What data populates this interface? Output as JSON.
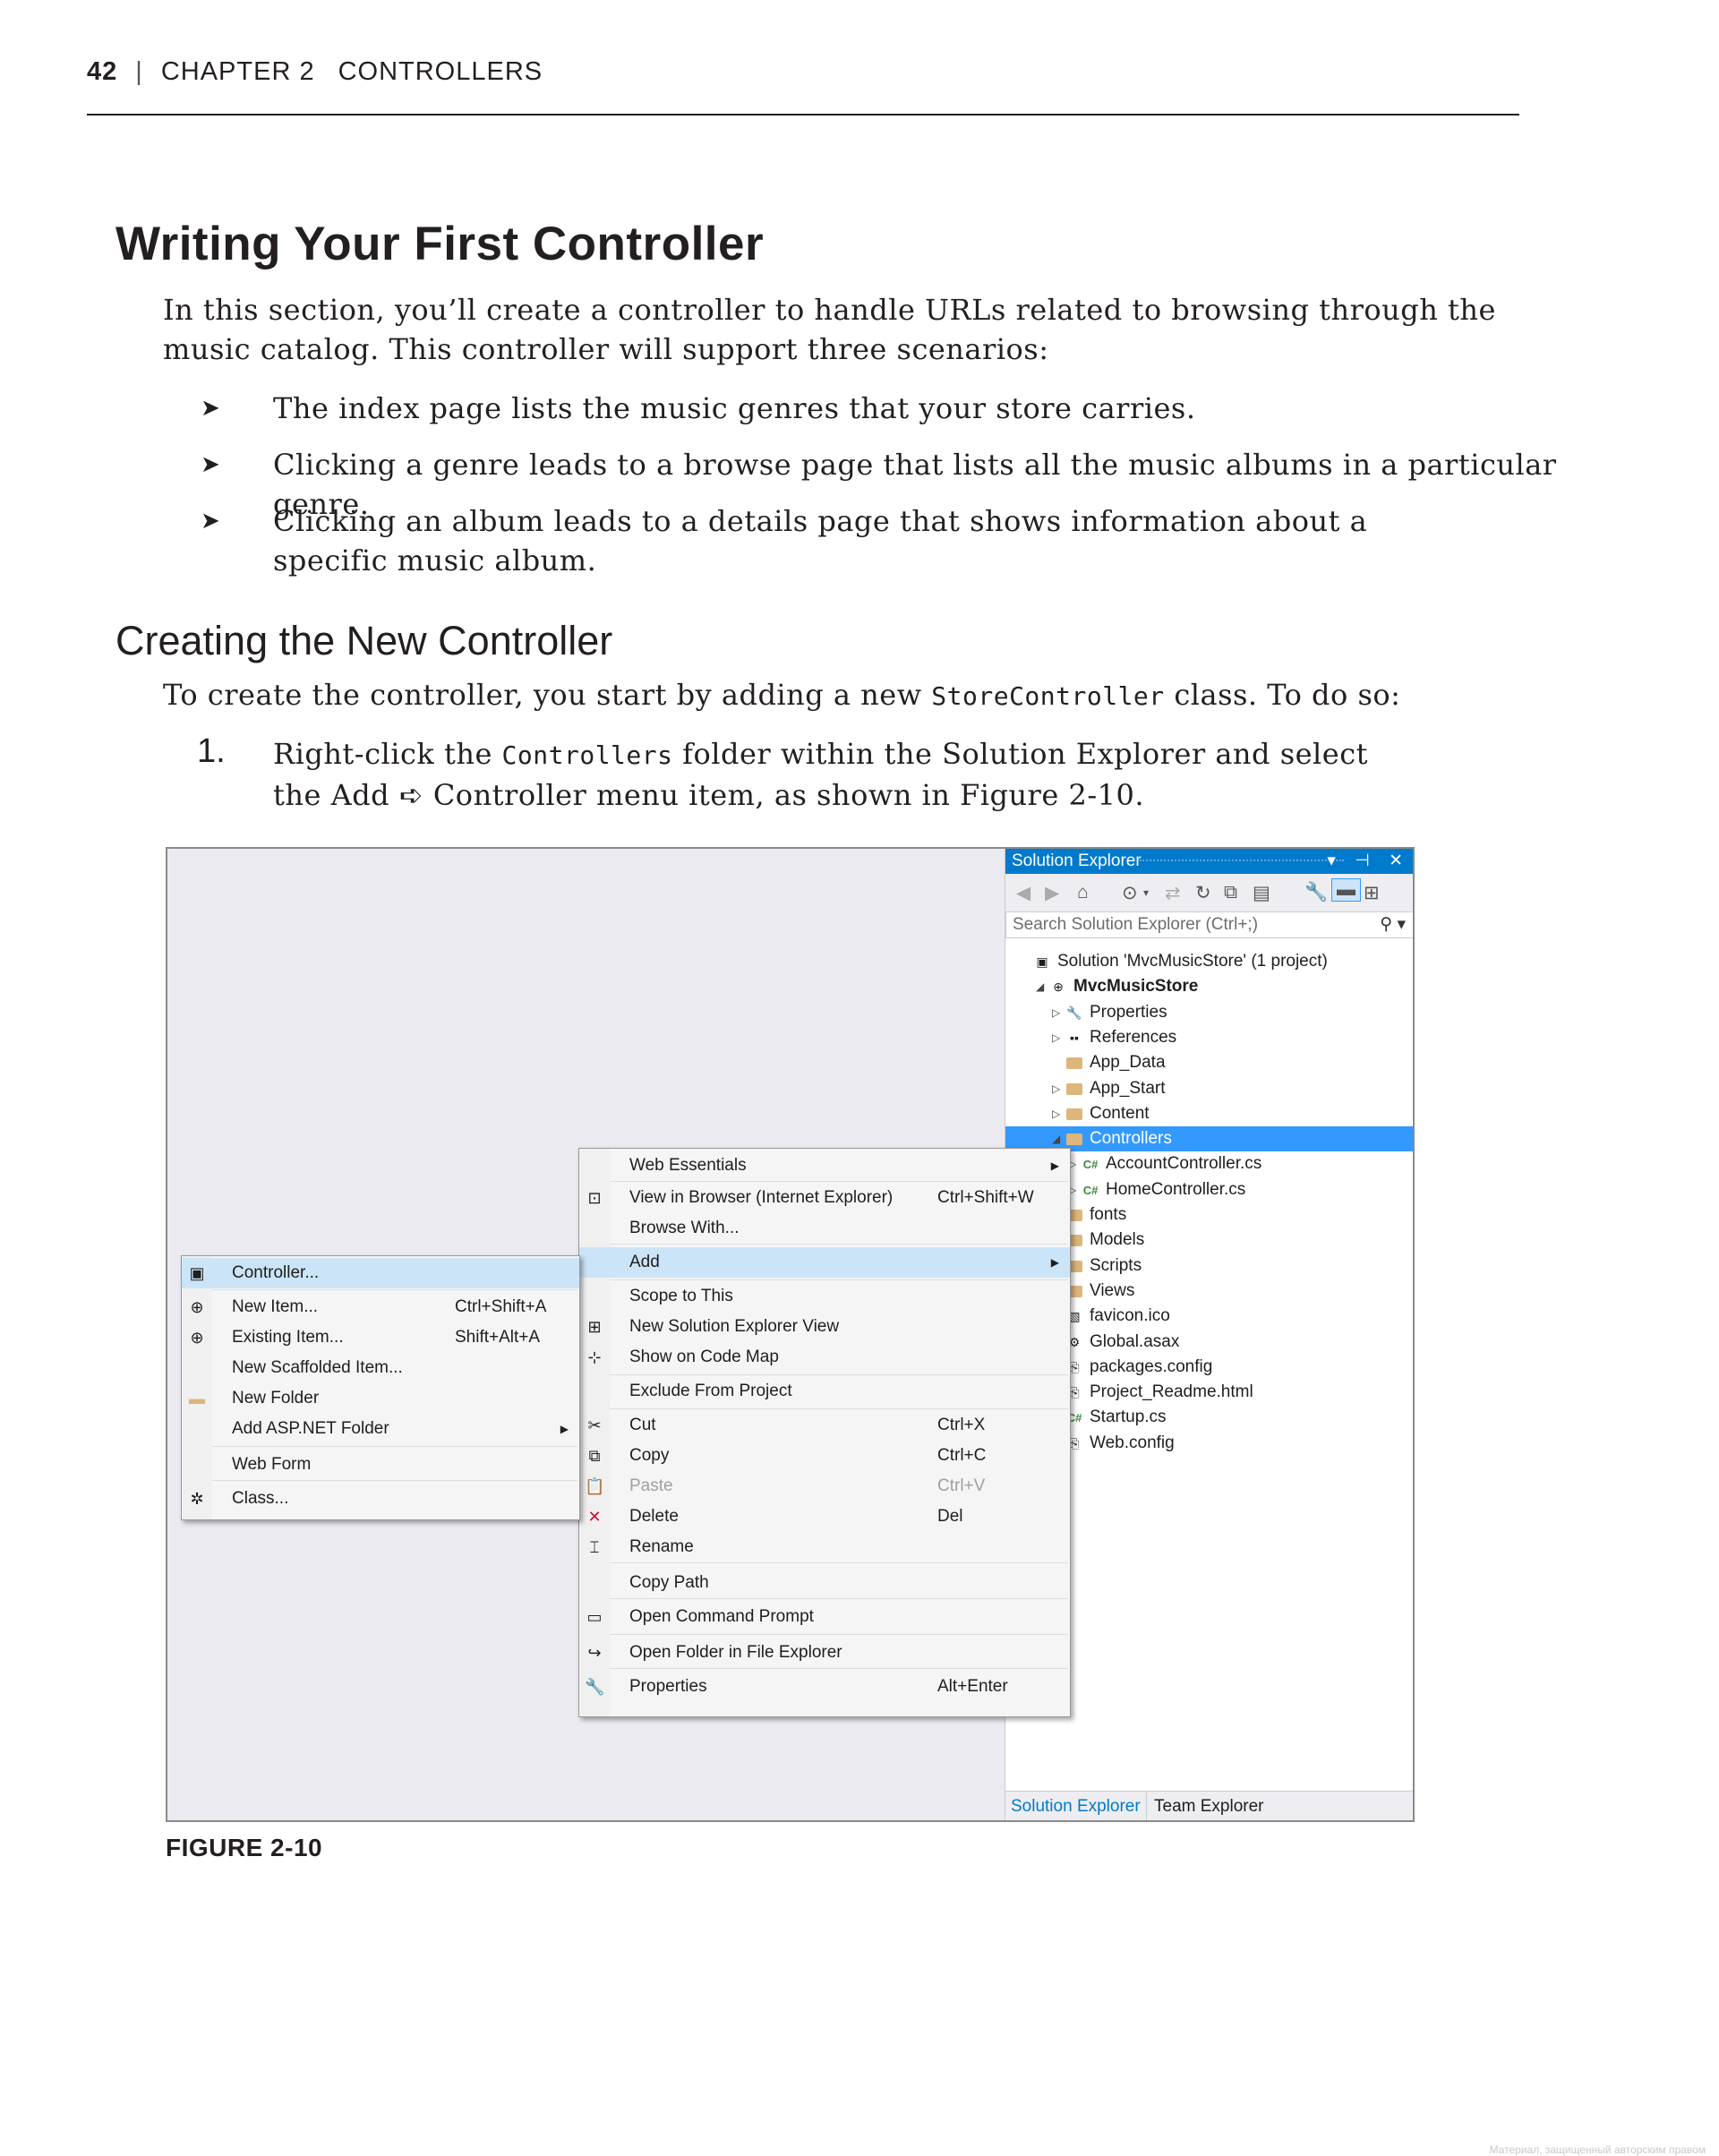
{
  "header": {
    "page_number": "42",
    "separator": "|",
    "chapter": "CHAPTER 2",
    "chapter_title": "CONTROLLERS"
  },
  "section": {
    "title": "Writing Your First Controller",
    "intro": "In this section, you’ll create a controller to handle URLs related to browsing through the music catalog. This controller will support three scenarios:",
    "bullet_marker": "➤",
    "bullets": [
      "The index page lists the music genres that your store carries.",
      "Clicking a genre leads to a browse page that lists all the music albums in a particular genre.",
      "Clicking an album leads to a details page that shows information about a specific music album."
    ]
  },
  "subsection": {
    "title": "Creating the New Controller",
    "intro_pre": "To create the controller, you start by adding a new ",
    "intro_code": "StoreController",
    "intro_post": " class. To do so:",
    "step_number": "1.",
    "step_pre": "Right-click the ",
    "step_code": "Controllers",
    "step_mid": " folder within the Solution Explorer and select the Add ",
    "step_arrow": "➪",
    "step_post": " Controller menu item, as shown in Figure 2-10."
  },
  "figure": {
    "caption": "FIGURE 2-10",
    "solution_explorer": {
      "title": "Solution Explorer",
      "title_buttons": "▾ ⊣ ✕",
      "search_placeholder": "Search Solution Explorer (Ctrl+;)",
      "tree": [
        {
          "label": "Solution 'MvcMusicStore' (1 project)",
          "icon": "solution-icon",
          "expander": "",
          "bold": false
        },
        {
          "label": "MvcMusicStore",
          "icon": "web-project-icon",
          "expander": "◢",
          "bold": true
        },
        {
          "label": "Properties",
          "icon": "wrench-icon",
          "expander": "▷",
          "bold": false
        },
        {
          "label": "References",
          "icon": "references-icon",
          "expander": "▷",
          "bold": false
        },
        {
          "label": "App_Data",
          "icon": "folder-icon",
          "expander": "",
          "bold": false
        },
        {
          "label": "App_Start",
          "icon": "folder-icon",
          "expander": "▷",
          "bold": false
        },
        {
          "label": "Content",
          "icon": "folder-icon",
          "expander": "▷",
          "bold": false
        },
        {
          "label": "Controllers",
          "icon": "folder-icon",
          "expander": "◢",
          "bold": false,
          "selected": true
        },
        {
          "label": "AccountController.cs",
          "icon": "csharp-file-icon",
          "expander": "▷",
          "bold": false
        },
        {
          "label": "HomeController.cs",
          "icon": "csharp-file-icon",
          "expander": "▷",
          "bold": false
        },
        {
          "label": "fonts",
          "icon": "folder-icon",
          "expander": "",
          "bold": false
        },
        {
          "label": "Models",
          "icon": "folder-icon",
          "expander": "",
          "bold": false
        },
        {
          "label": "Scripts",
          "icon": "folder-icon",
          "expander": "",
          "bold": false
        },
        {
          "label": "Views",
          "icon": "folder-icon",
          "expander": "",
          "bold": false
        },
        {
          "label": "favicon.ico",
          "icon": "image-file-icon",
          "expander": "",
          "bold": false
        },
        {
          "label": "Global.asax",
          "icon": "gear-file-icon",
          "expander": "",
          "bold": false
        },
        {
          "label": "packages.config",
          "icon": "config-file-icon",
          "expander": "",
          "bold": false
        },
        {
          "label": "Project_Readme.html",
          "icon": "html-file-icon",
          "expander": "",
          "bold": false
        },
        {
          "label": "Startup.cs",
          "icon": "csharp-file-icon",
          "expander": "",
          "bold": false
        },
        {
          "label": "Web.config",
          "icon": "config-file-icon",
          "expander": "",
          "bold": false
        }
      ],
      "bottom_tabs": [
        "Solution Explorer",
        "Team Explorer"
      ],
      "active_tab_color": "#007acc"
    },
    "context_menu": [
      {
        "label": "Web Essentials",
        "shortcut": "",
        "icon": "",
        "submenu": true
      },
      {
        "label": "View in Browser (Internet Explorer)",
        "shortcut": "Ctrl+Shift+W",
        "icon": "browser-icon"
      },
      {
        "label": "Browse With...",
        "shortcut": "",
        "icon": ""
      },
      {
        "label": "Add",
        "shortcut": "",
        "icon": "",
        "submenu": true,
        "highlighted": true
      },
      {
        "label": "Scope to This",
        "shortcut": "",
        "icon": ""
      },
      {
        "label": "New Solution Explorer View",
        "shortcut": "",
        "icon": "new-view-icon"
      },
      {
        "label": "Show on Code Map",
        "shortcut": "",
        "icon": "code-map-icon"
      },
      {
        "label": "Exclude From Project",
        "shortcut": "",
        "icon": ""
      },
      {
        "label": "Cut",
        "shortcut": "Ctrl+X",
        "icon": "scissors-icon"
      },
      {
        "label": "Copy",
        "shortcut": "Ctrl+C",
        "icon": "copy-icon"
      },
      {
        "label": "Paste",
        "shortcut": "Ctrl+V",
        "icon": "paste-icon",
        "disabled": true
      },
      {
        "label": "Delete",
        "shortcut": "Del",
        "icon": "delete-icon"
      },
      {
        "label": "Rename",
        "shortcut": "",
        "icon": "rename-icon"
      },
      {
        "label": "Copy Path",
        "shortcut": "",
        "icon": ""
      },
      {
        "label": "Open Command Prompt",
        "shortcut": "",
        "icon": "command-prompt-icon"
      },
      {
        "label": "Open Folder in File Explorer",
        "shortcut": "",
        "icon": "open-folder-icon"
      },
      {
        "label": "Properties",
        "shortcut": "Alt+Enter",
        "icon": "wrench-icon"
      }
    ],
    "add_submenu": [
      {
        "label": "Controller...",
        "shortcut": "",
        "icon": "controller-icon",
        "highlighted": true
      },
      {
        "label": "New Item...",
        "shortcut": "Ctrl+Shift+A",
        "icon": "new-item-icon"
      },
      {
        "label": "Existing Item...",
        "shortcut": "Shift+Alt+A",
        "icon": "existing-item-icon"
      },
      {
        "label": "New Scaffolded Item...",
        "shortcut": "",
        "icon": ""
      },
      {
        "label": "New Folder",
        "shortcut": "",
        "icon": "folder-icon"
      },
      {
        "label": "Add ASP.NET Folder",
        "shortcut": "",
        "icon": "",
        "submenu": true
      },
      {
        "label": "Web Form",
        "shortcut": "",
        "icon": ""
      },
      {
        "label": "Class...",
        "shortcut": "",
        "icon": "class-icon"
      }
    ]
  },
  "watermark": "Материал, защищенный авторским правом"
}
